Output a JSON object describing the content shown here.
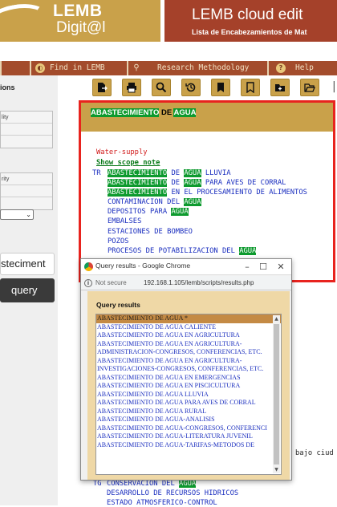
{
  "header": {
    "brand_top": "LEMB",
    "brand_bottom": "Digit@l",
    "title": "LEMB cloud edit",
    "subtitle": "Lista de Encabezamientos de Mat"
  },
  "nav": {
    "items": [
      {
        "label": "Find in LEMB"
      },
      {
        "label": "Research Methodology"
      },
      {
        "label": "Help"
      }
    ]
  },
  "sidebar": {
    "section_label": "ions",
    "box1_rows": [
      "lity",
      "",
      ""
    ],
    "box2_rows": [
      "rity",
      "",
      ""
    ],
    "search_value": "steciment",
    "query_button": "query"
  },
  "toolbar": {
    "buttons": [
      "file-export-icon",
      "print-icon",
      "search-icon",
      "history-icon",
      "bookmark-filled-icon",
      "bookmark-outline-icon",
      "folder-add-icon",
      "folder-open-icon"
    ]
  },
  "record": {
    "heading_parts": [
      "ABASTECIMIENTO",
      "DE",
      "AGUA"
    ],
    "used_for": "Water-supply",
    "scope_note_link": "Show scope note",
    "tr_prefix": "TR",
    "terms": [
      "ABASTECIMIENTO DE AGUA LLUVIA",
      "ABASTECIMIENTO DE AGUA PARA AVES DE CORRAL",
      "ABASTECIMIENTO EN EL PROCESAMIENTO DE ALIMENTOS",
      "CONTAMINACION DEL AGUA",
      "DEPOSITOS PARA AGUA",
      "EMBALSES",
      "ESTACIONES DE BOMBEO",
      "POZOS",
      "PROCESOS DE POTABILIZACION DEL AGUA"
    ],
    "behind_right": "bajo ciud",
    "tg_prefix": "TG",
    "tg_terms": [
      "CONSERVACION DEL AGUA",
      "DESARROLLO DE RECURSOS HIDRICOS",
      "ESTADO ATMOSFERICO-CONTROL"
    ]
  },
  "popup": {
    "window_title": "Query results - Google Chrome",
    "address_security": "Not secure",
    "address_url": "192.168.1.105/lemb/scripts/results.php",
    "heading": "Query results",
    "results": [
      "ABASTECIMIENTO DE AGUA *",
      "ABASTECIMIENTO DE AGUA CALIENTE",
      "ABASTECIMIENTO DE AGUA EN AGRICULTURA",
      "ABASTECIMIENTO DE AGUA EN AGRICULTURA-",
      "ADMINISTRACION-CONGRESOS, CONFERENCIAS, ETC.",
      "ABASTECIMIENTO DE AGUA EN AGRICULTURA-",
      "INVESTIGACIONES-CONGRESOS, CONFERENCIAS, ETC.",
      "ABASTECIMIENTO DE AGUA EN EMERGENCIAS",
      "ABASTECIMIENTO DE AGUA EN PISCICULTURA",
      "ABASTECIMIENTO DE AGUA LLUVIA",
      "ABASTECIMIENTO DE AGUA PARA AVES DE CORRAL",
      "ABASTECIMIENTO DE AGUA RURAL",
      "ABASTECIMIENTO DE AGUA-ANALISIS",
      "ABASTECIMIENTO DE AGUA-CONGRESOS, CONFERENCI",
      "ABASTECIMIENTO DE AGUA-LITERATURA JUVENIL",
      "ABASTECIMIENTO DE AGUA-TARIFAS-METODOS DE"
    ]
  }
}
